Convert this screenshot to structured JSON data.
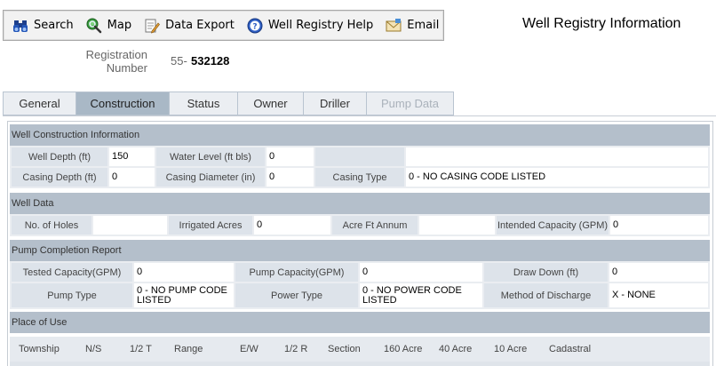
{
  "toolbar": {
    "search": "Search",
    "map": "Map",
    "export": "Data Export",
    "help": "Well Registry Help",
    "email": "Email"
  },
  "page_title": "Well Registry Information",
  "registration": {
    "label_line1": "Registration",
    "label_line2": "Number",
    "prefix": "55-",
    "number": "532128"
  },
  "tabs": [
    "General",
    "Construction",
    "Status",
    "Owner",
    "Driller",
    "Pump Data"
  ],
  "construction": {
    "header": "Well Construction Information",
    "well_depth_label": "Well Depth (ft)",
    "well_depth": "150",
    "water_level_label": "Water Level (ft bls)",
    "water_level": "0",
    "casing_depth_label": "Casing Depth (ft)",
    "casing_depth": "0",
    "casing_diameter_label": "Casing Diameter (in)",
    "casing_diameter": "0",
    "casing_type_label": "Casing Type",
    "casing_type": "0 - NO CASING CODE LISTED"
  },
  "well_data": {
    "header": "Well Data",
    "holes_label": "No. of Holes",
    "irrigated_label": "Irrigated Acres",
    "irrigated": "0",
    "acre_ft_label": "Acre Ft Annum",
    "capacity_label": "Intended Capacity (GPM)",
    "capacity": "0"
  },
  "pump": {
    "header": "Pump Completion Report",
    "tested_label": "Tested Capacity(GPM)",
    "tested": "0",
    "pump_capacity_label": "Pump Capacity(GPM)",
    "pump_capacity": "0",
    "draw_down_label": "Draw Down (ft)",
    "draw_down": "0",
    "pump_type_label": "Pump Type",
    "pump_type": "0 - NO PUMP CODE LISTED",
    "power_type_label": "Power Type",
    "power_type": "0 - NO POWER CODE LISTED",
    "discharge_label": "Method of Discharge",
    "discharge": "X - NONE"
  },
  "place_of_use": {
    "header": "Place of Use",
    "columns": [
      "Township",
      "N/S",
      "1/2 T",
      "Range",
      "E/W",
      "1/2 R",
      "Section",
      "160 Acre",
      "40 Acre",
      "10 Acre",
      "Cadastral"
    ]
  }
}
